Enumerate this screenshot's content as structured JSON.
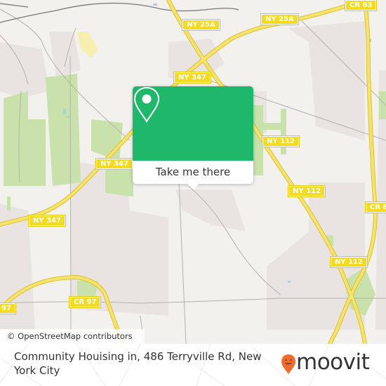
{
  "map": {
    "attribution": "© OpenStreetMap contributors",
    "road_labels": [
      {
        "id": "ny25a-1",
        "text": "NY 25A"
      },
      {
        "id": "ny25a-2",
        "text": "NY 25A"
      },
      {
        "id": "cr83-1",
        "text": "CR 83"
      },
      {
        "id": "ny347-1",
        "text": "NY 347"
      },
      {
        "id": "ny347-2",
        "text": "NY 347"
      },
      {
        "id": "ny347-3",
        "text": "NY 347"
      },
      {
        "id": "ny112-1",
        "text": "NY 112"
      },
      {
        "id": "ny112-2",
        "text": "NY 112"
      },
      {
        "id": "ny112-3",
        "text": "NY 112"
      },
      {
        "id": "cr83-2",
        "text": "CR 8"
      },
      {
        "id": "cr97-1",
        "text": "CR 97"
      },
      {
        "id": "cr97-2",
        "text": "97"
      }
    ],
    "colors": {
      "background": "#f2f1ee",
      "residential": "#e8e3e1",
      "park": "#c8e0a8",
      "water": "#aad3df",
      "road_major": "#f7e36b",
      "road_casing": "#e0c83a",
      "rail": "#777777"
    }
  },
  "popup": {
    "action_label": "Take me there",
    "icon": "location-pin-icon",
    "accent_color": "#1fb86b"
  },
  "footer": {
    "address": "Community Houising in, 486 Terryville Rd, New York City",
    "brand": "moovit",
    "brand_color": "#f26b2d"
  }
}
